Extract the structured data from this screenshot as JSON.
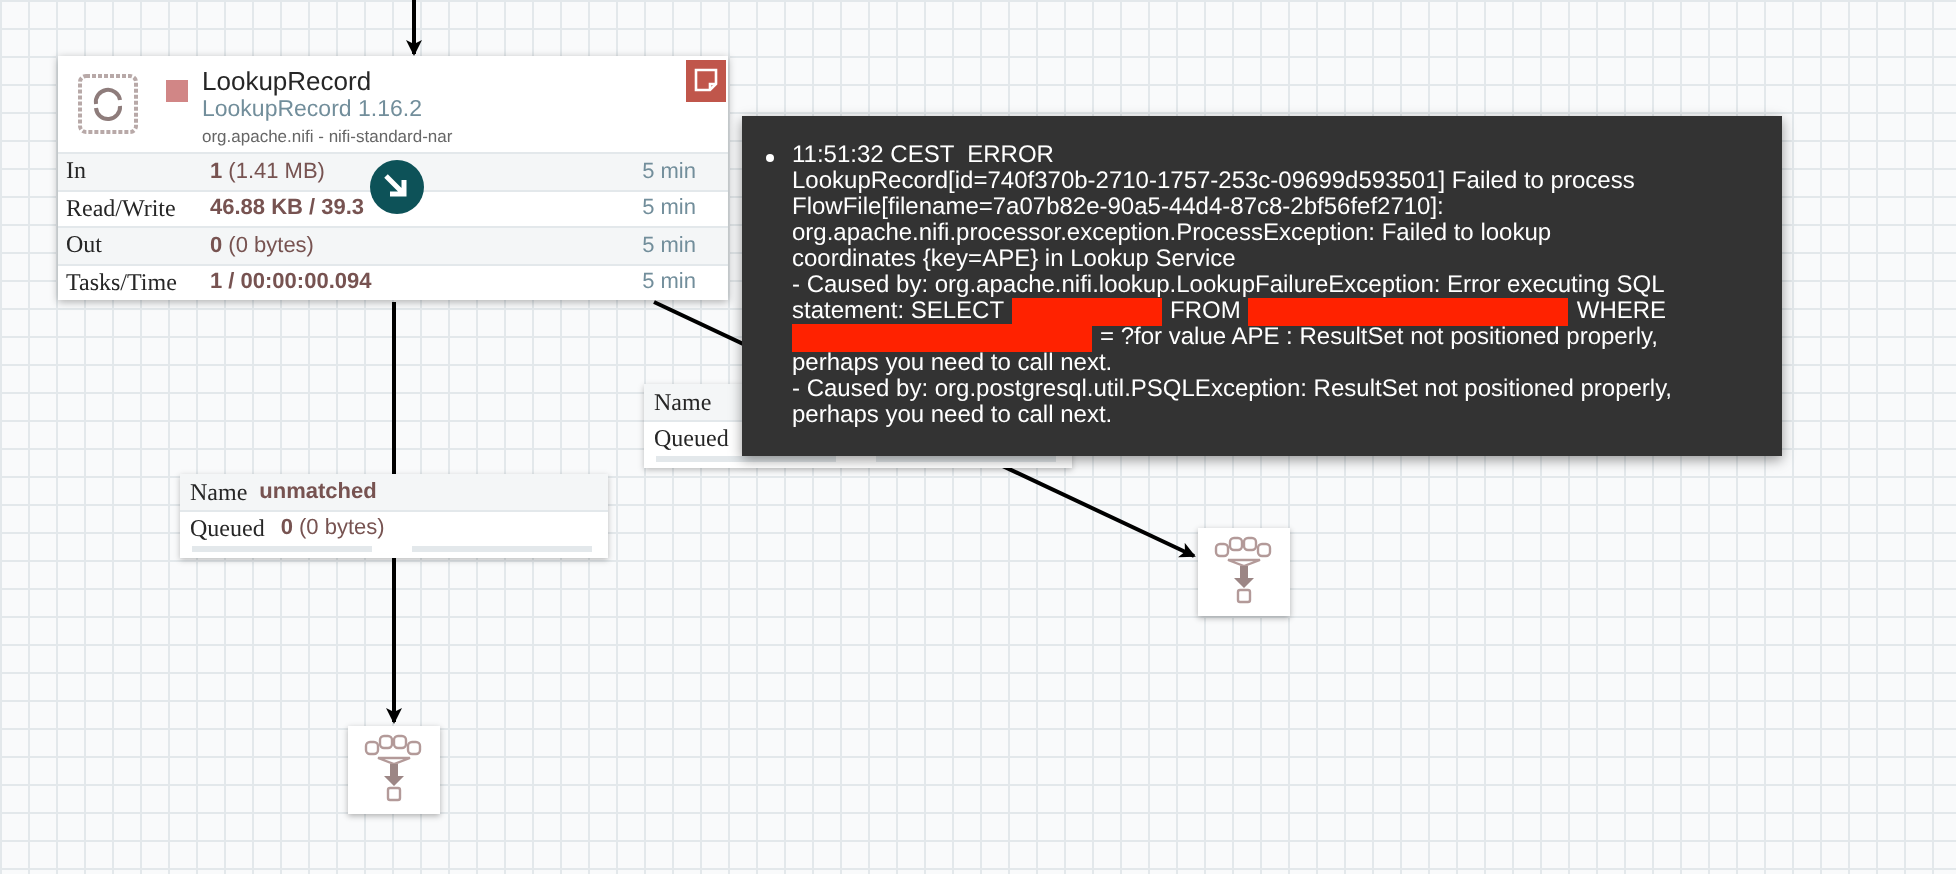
{
  "processor": {
    "name": "LookupRecord",
    "type": "LookupRecord 1.16.2",
    "bundle": "org.apache.nifi - nifi-standard-nar",
    "stats": [
      {
        "label": "In",
        "value": "1",
        "detail": "(1.41 MB)",
        "window": "5 min"
      },
      {
        "label": "Read/Write",
        "value": "46.88 KB / 39.3",
        "window": "5 min"
      },
      {
        "label": "Out",
        "value": "0",
        "detail": "(0 bytes)",
        "window": "5 min"
      },
      {
        "label": "Tasks/Time",
        "value": "1 / 00:00:00.094",
        "window": "5 min"
      }
    ]
  },
  "connections": [
    {
      "name_label": "Name",
      "name": "unmatched",
      "queued_label": "Queued",
      "queued": "0",
      "queued_detail": "(0 bytes)"
    },
    {
      "name_label": "Name",
      "queued_label": "Queued"
    }
  ],
  "bulletin": {
    "header": "11:51:32 CEST  ERROR",
    "lines": [
      [
        {
          "kind": "text",
          "text": "LookupRecord[id=740f370b-2710-1757-253c-09699d593501] Failed to process"
        }
      ],
      [
        {
          "kind": "text",
          "text": "FlowFile[filename=7a07b82e-90a5-44d4-87c8-2bf56fef2710]:"
        }
      ],
      [
        {
          "kind": "text",
          "text": "org.apache.nifi.processor.exception.ProcessException: Failed to lookup"
        }
      ],
      [
        {
          "kind": "text",
          "text": "coordinates {key=APE} in Lookup Service"
        }
      ],
      [
        {
          "kind": "text",
          "text": "- Caused by: org.apache.nifi.lookup.LookupFailureException: Error executing SQL"
        }
      ],
      [
        {
          "kind": "text",
          "text": "statement: SELECT"
        },
        {
          "kind": "redaction"
        },
        {
          "kind": "text",
          "text": "FROM"
        },
        {
          "kind": "redaction"
        },
        {
          "kind": "text",
          "text": "WHERE"
        }
      ],
      [
        {
          "kind": "redaction"
        },
        {
          "kind": "text",
          "text": "= ?for value APE : ResultSet not positioned properly,"
        }
      ],
      [
        {
          "kind": "text",
          "text": "perhaps you need to call next."
        }
      ],
      [
        {
          "kind": "text",
          "text": "- Caused by: org.postgresql.util.PSQLException: ResultSet not positioned properly,"
        }
      ],
      [
        {
          "kind": "text",
          "text": "perhaps you need to call next."
        }
      ]
    ]
  }
}
